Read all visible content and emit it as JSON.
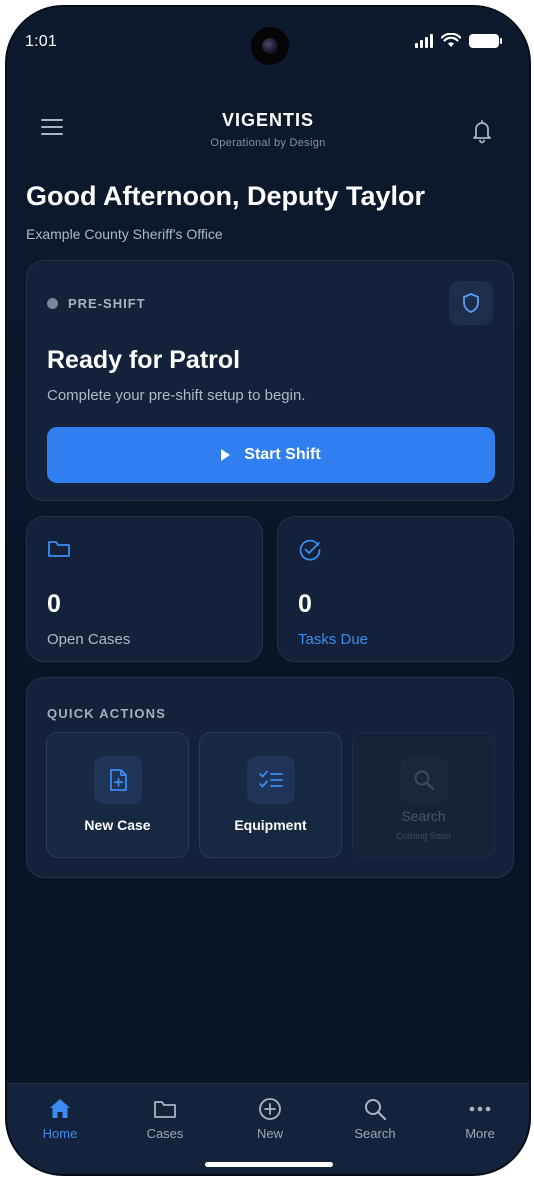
{
  "status_bar": {
    "time": "1:01"
  },
  "header": {
    "title": "VIGENTIS",
    "subtitle": "Operational by Design",
    "menu_icon": "hamburger-menu-icon",
    "notification_icon": "bell-icon"
  },
  "greeting": "Good Afternoon, Deputy Taylor",
  "office": "Example County Sheriff's Office",
  "shift_card": {
    "status": "PRE-SHIFT",
    "status_icon": "shield-icon",
    "title": "Ready for Patrol",
    "subtitle": "Complete your pre-shift setup to begin.",
    "button_label": "Start Shift",
    "button_color": "#2f7ff0"
  },
  "stats": [
    {
      "value": "0",
      "label": "Open Cases",
      "icon": "folder-icon"
    },
    {
      "value": "0",
      "label": "Tasks Due",
      "icon": "check-circle-icon"
    }
  ],
  "quick_actions": {
    "heading": "QUICK ACTIONS",
    "items": [
      {
        "label": "New Case",
        "icon": "file-plus-icon"
      },
      {
        "label": "Equipment",
        "icon": "checklist-icon"
      },
      {
        "label": "Search",
        "sub": "Coming Soon",
        "icon": "search-icon",
        "disabled": true
      }
    ]
  },
  "bottom_nav": {
    "items": [
      {
        "label": "Home",
        "icon": "home-icon",
        "active": true
      },
      {
        "label": "Cases",
        "icon": "folder-icon"
      },
      {
        "label": "New",
        "icon": "plus-circle-icon"
      },
      {
        "label": "Search",
        "icon": "search-icon"
      },
      {
        "label": "More",
        "icon": "more-dots-icon"
      }
    ]
  },
  "colors": {
    "accent": "#3b8bf0",
    "background": "#0a1628",
    "card": "#13223a"
  }
}
